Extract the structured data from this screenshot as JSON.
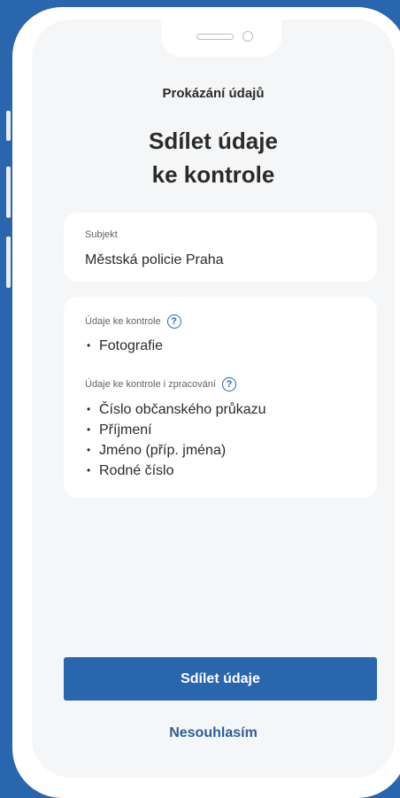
{
  "app_bar": {
    "title": "Prokázání údajů"
  },
  "page": {
    "title_line1": "Sdílet údaje",
    "title_line2": "ke kontrole"
  },
  "subject": {
    "label": "Subjekt",
    "value": "Městská policie Praha"
  },
  "inspection_data": {
    "label": "Údaje ke kontrole",
    "items": [
      "Fotografie"
    ]
  },
  "inspection_processing_data": {
    "label": "Údaje ke kontrole i zpracování",
    "items": [
      "Číslo občanského průkazu",
      "Příjmení",
      "Jméno (příp. jména)",
      "Rodné číslo"
    ]
  },
  "icons": {
    "help": "?"
  },
  "actions": {
    "share_label": "Sdílet údaje",
    "decline_label": "Nesouhlasím"
  },
  "colors": {
    "background": "#2a66ad",
    "primary": "#2a66ad",
    "screen": "#f5f6f7",
    "card": "#ffffff",
    "text": "#2b2b2b"
  }
}
